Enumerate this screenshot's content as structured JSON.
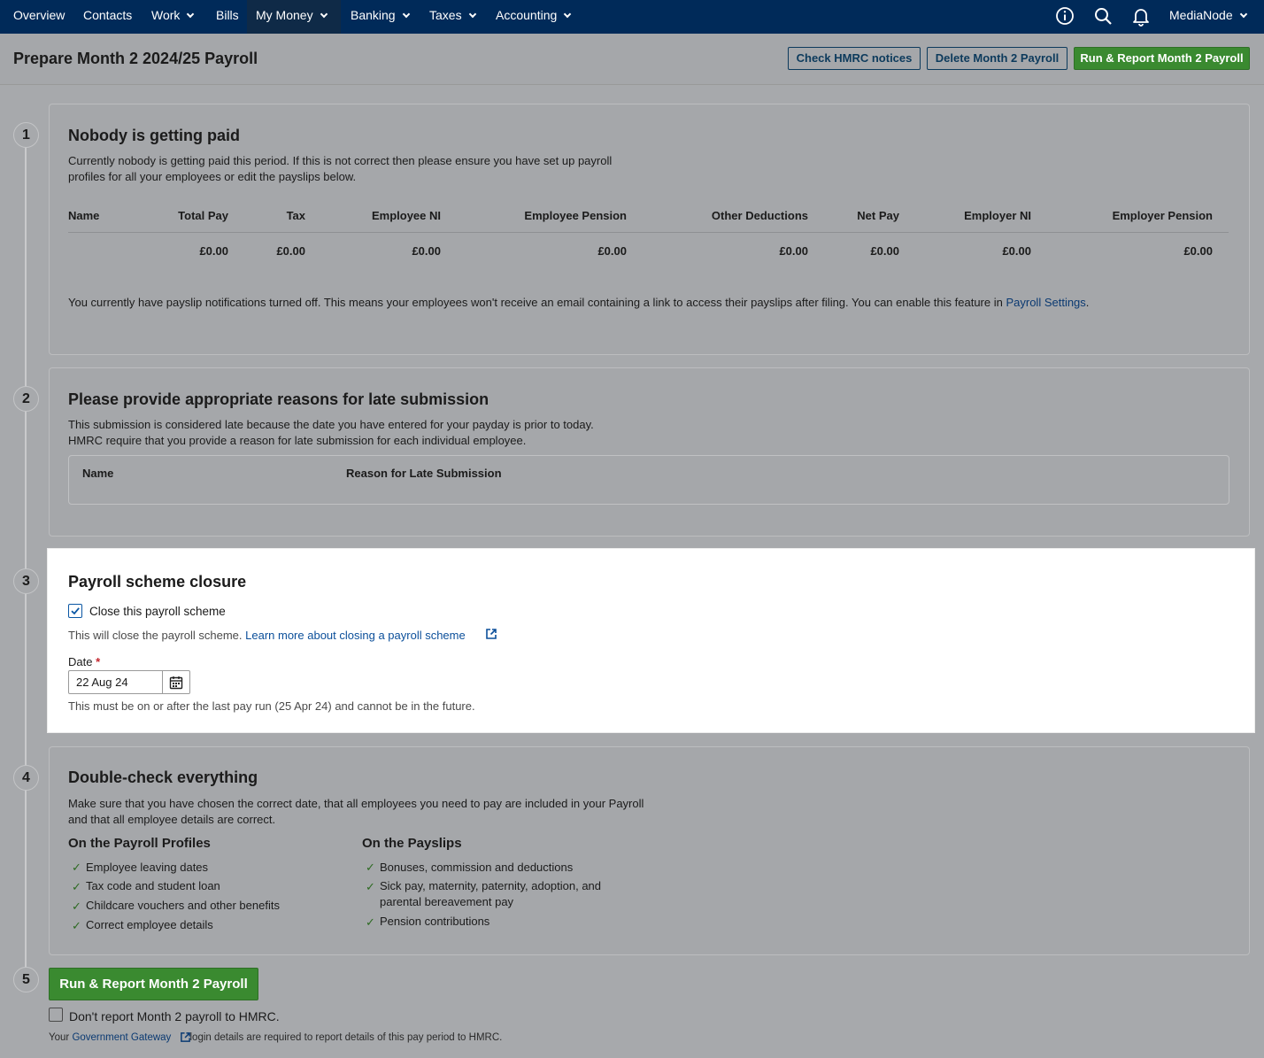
{
  "nav": {
    "items": [
      "Overview",
      "Contacts",
      "Work",
      "Bills",
      "My Money",
      "Banking",
      "Taxes",
      "Accounting"
    ],
    "account": "MediaNode",
    "icons": [
      "info-icon",
      "search-icon",
      "bell-icon"
    ]
  },
  "header": {
    "title": "Prepare Month 2 2024/25 Payroll",
    "check_notices": "Check HMRC notices",
    "delete_payroll": "Delete Month 2 Payroll",
    "run_report": "Run & Report Month 2 Payroll"
  },
  "steps": [
    "1",
    "2",
    "3",
    "4",
    "5"
  ],
  "section1": {
    "title": "Nobody is getting paid",
    "desc_line1": "Currently nobody is getting paid this period. If this is not correct then please ensure you have set up payroll",
    "desc_line2": "profiles for all your employees or edit the payslips below.",
    "columns": [
      "Name",
      "Total Pay",
      "Tax",
      "Employee NI",
      "Employee Pension",
      "Other Deductions",
      "Net Pay",
      "Employer NI",
      "Employer Pension"
    ],
    "totals": [
      "£0.00",
      "£0.00",
      "£0.00",
      "£0.00",
      "£0.00",
      "£0.00",
      "£0.00",
      "£0.00"
    ],
    "notice": "You currently have payslip notifications turned off. This means your employees won't receive an email containing a link to access their payslips after filing. You can enable this feature in ",
    "notice_link": "Payroll Settings",
    "notice_end": "."
  },
  "section2": {
    "title": "Please provide appropriate reasons for late submission",
    "desc_line1": "This submission is considered late because the date you have entered for your payday is prior to today.",
    "desc_line2": "HMRC require that you provide a reason for late submission for each individual employee.",
    "col_name": "Name",
    "col_reason": "Reason for Late Submission"
  },
  "section3": {
    "title": "Payroll scheme closure",
    "checkbox_label": "Close this payroll scheme",
    "checked": true,
    "info": "This will close the payroll scheme. ",
    "info_link": "Learn more about closing a payroll scheme",
    "date_label": "Date",
    "required_mark": "*",
    "date_value": "22 Aug 24",
    "hint": "This must be on or after the last pay run (25 Apr 24) and cannot be in the future."
  },
  "section4": {
    "title": "Double-check everything",
    "desc_line1": "Make sure that you have chosen the correct date, that all employees you need to pay are included in your Payroll",
    "desc_line2": "and that all employee details are correct.",
    "profiles_heading": "On the Payroll Profiles",
    "profiles": [
      "Employee leaving dates",
      "Tax code and student loan",
      "Childcare vouchers and other benefits",
      "Correct employee details"
    ],
    "payslips_heading": "On the Payslips",
    "payslips": [
      "Bonuses, commission and deductions",
      "Sick pay, maternity, paternity, adoption, and",
      "parental bereavement pay",
      "Pension contributions"
    ],
    "tick": "✓"
  },
  "section5": {
    "run_button": "Run & Report Month 2 Payroll",
    "dont_report": "Don't report Month 2 payroll to HMRC.",
    "footer_pre": "Your ",
    "footer_link": "Government Gateway",
    "footer_post": " login details are required to report details of this pay period to HMRC."
  },
  "colors": {
    "nav": "#002a59",
    "green": "#3a8a30",
    "link": "#0b3a72",
    "overlay": "#a7a9ac"
  }
}
